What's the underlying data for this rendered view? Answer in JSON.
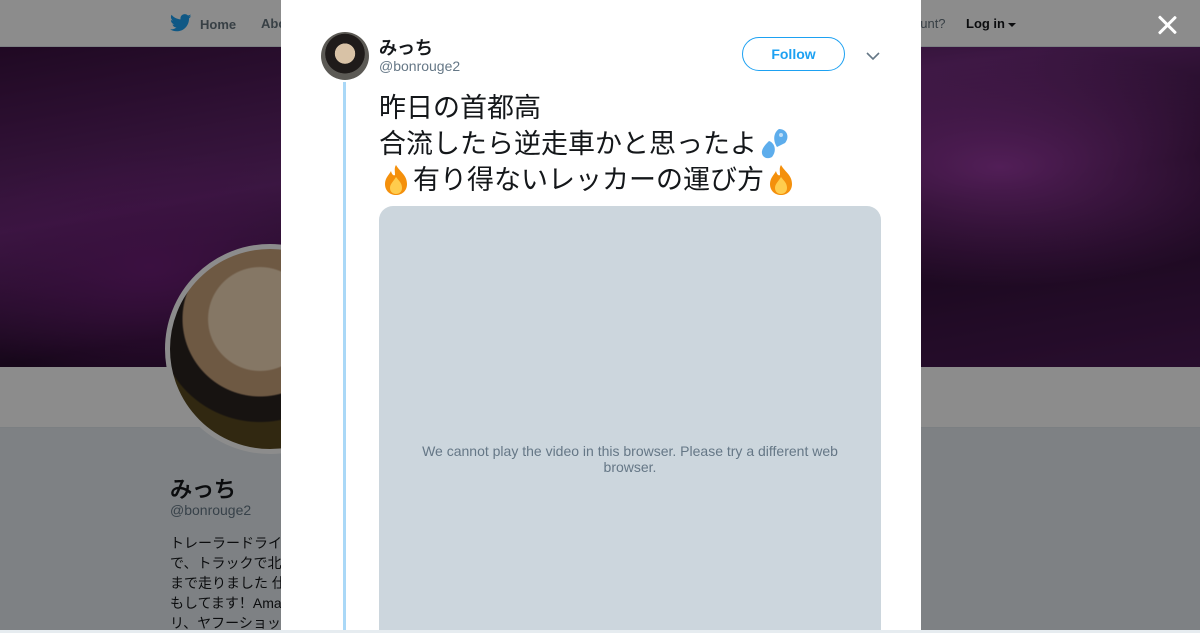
{
  "nav": {
    "home_label": "Home",
    "about_label": "Abo",
    "account_text": "ccount?",
    "login_label": "Log in"
  },
  "profile": {
    "name": "みっち",
    "handle": "@bonrouge2",
    "bio": "トレーラードライ\nで、トラックで北\nまで走りました 仕\nもしてます！Ama\nリ、ヤフーショッ"
  },
  "tweet": {
    "author_name": "みっち",
    "author_handle": "@bonrouge2",
    "follow_label": "Follow",
    "lines": [
      {
        "text": "昨日の首都高"
      },
      {
        "text": "合流したら逆走車かと思ったよ"
      },
      {
        "text": "有り得ないレッカーの運び方"
      }
    ],
    "video_message": "We cannot play the video in this browser. Please try a different web browser."
  },
  "colors": {
    "accent": "#1da1f2",
    "thread_line": "#aad8f7",
    "video_bg": "#ccd6dd"
  },
  "icons": [
    "twitter-bird-icon",
    "close-icon",
    "chevron-down-icon",
    "sweat-drops-emoji",
    "fire-emoji"
  ]
}
